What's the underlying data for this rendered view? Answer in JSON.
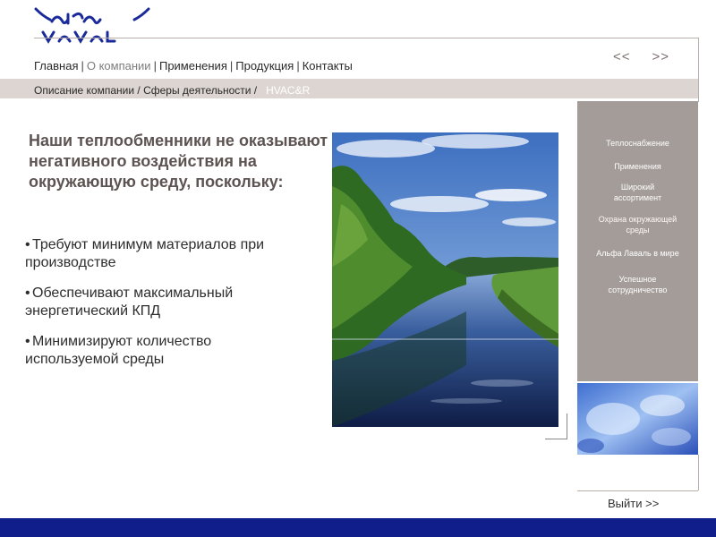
{
  "nav": {
    "items": [
      "Главная",
      "О компании",
      "Применения",
      "Продукция",
      "Контакты"
    ],
    "active_index": 1,
    "prev": "<<",
    "next": ">>"
  },
  "breadcrumb": {
    "path": "Описание компании / Сферы деятельности /",
    "current": "HVAC&R"
  },
  "headline": "Наши теплообменники не оказывают негативного воздействия на окружающую среду, поскольку:",
  "bullets": [
    "Требуют минимум материалов при производстве",
    "Обеспечивают максимальный энергетический КПД",
    "Минимизируют количество используемой среды"
  ],
  "sidebar": {
    "items": [
      "Теплоснабжение",
      "Применения",
      "Широкий ассортимент",
      "Охрана окружающей среды",
      "Альфа Лаваль в мире",
      "Успешное сотрудничество"
    ],
    "active_index": 3
  },
  "exit_label": "Выйти >>",
  "colors": {
    "brand_blue": "#1a2a9a",
    "footer": "#0f1e8a",
    "sidebar": "#a39c99",
    "crumb_bar": "#ddd5d1",
    "headline": "#5d5452"
  }
}
